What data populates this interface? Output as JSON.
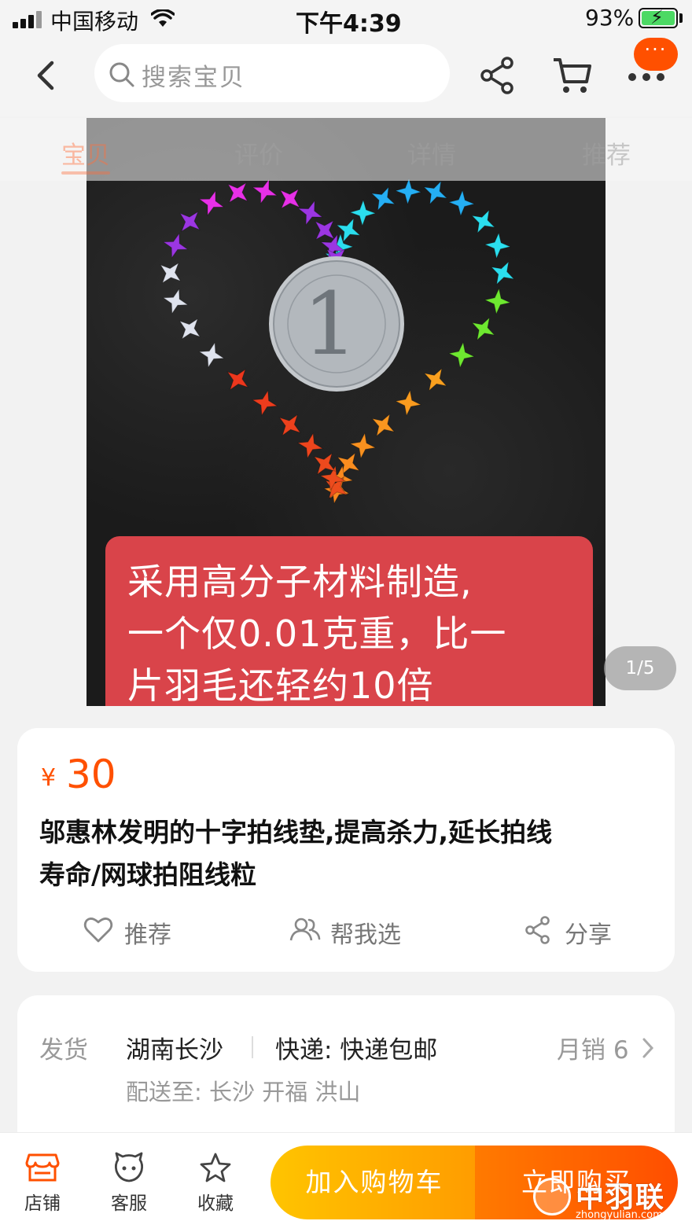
{
  "status_bar": {
    "carrier": "中国移动",
    "time": "下午4:39",
    "battery": "93%"
  },
  "search": {
    "placeholder": "搜索宝贝"
  },
  "header": {
    "message_badge": "···"
  },
  "tabs": [
    "宝贝",
    "评价",
    "详情",
    "推荐"
  ],
  "gallery": {
    "caption_lines": [
      "采用高分子材料制造,",
      "一个仅0.01克重，比一",
      "片羽毛还轻约10倍"
    ],
    "counter": "1/5",
    "coin_text": "1"
  },
  "product": {
    "currency": "¥",
    "price": "30",
    "title_lines": [
      "邬惠林发明的十字拍线垫,提高杀力,延长拍线",
      "寿命/网球拍阻线粒"
    ],
    "actions": [
      "推荐",
      "帮我选",
      "分享"
    ]
  },
  "shipping": {
    "label": "发货",
    "location": "湖南长沙",
    "express": "快递: 快递包邮",
    "sales": "月销 6",
    "destination": "配送至: 长沙 开福 洪山"
  },
  "bottom_bar": {
    "store": "店铺",
    "service": "客服",
    "favorite": "收藏",
    "add_to_cart": "加入购物车",
    "buy_now": "立即购买"
  },
  "watermark": {
    "text": "中羽联",
    "url": "zhongyulian.com"
  },
  "colors": {
    "accent": "#ff5000",
    "cart_button": "#ffb000",
    "buy_button": "#ff5a00",
    "caption_bg": "#d9444a"
  }
}
